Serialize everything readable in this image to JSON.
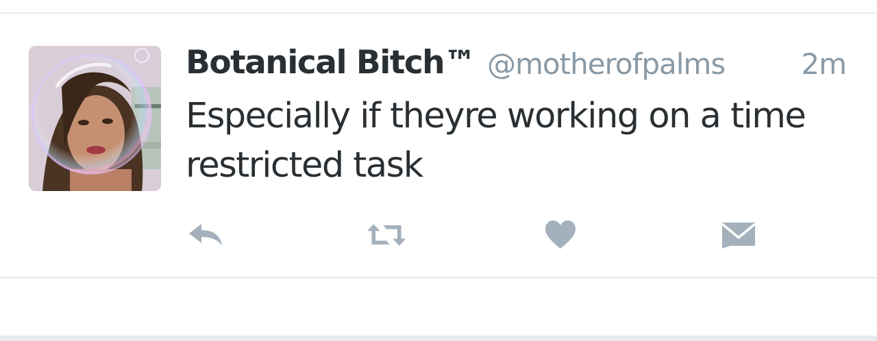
{
  "tweet": {
    "display_name": "Botanical Bitch™",
    "handle": "@motherofpalms",
    "timestamp": "2m",
    "text_line_1": "Especially if theyre working on a time",
    "text_line_2": "restricted task"
  },
  "actions": [
    {
      "name": "reply",
      "icon": "reply-icon"
    },
    {
      "name": "retweet",
      "icon": "retweet-icon"
    },
    {
      "name": "like",
      "icon": "heart-icon"
    },
    {
      "name": "direct-message",
      "icon": "envelope-icon"
    }
  ],
  "colors": {
    "name": "#292f33",
    "meta": "#8899a6",
    "icon": "#a4b1bc",
    "divider": "#e6ecf0"
  }
}
